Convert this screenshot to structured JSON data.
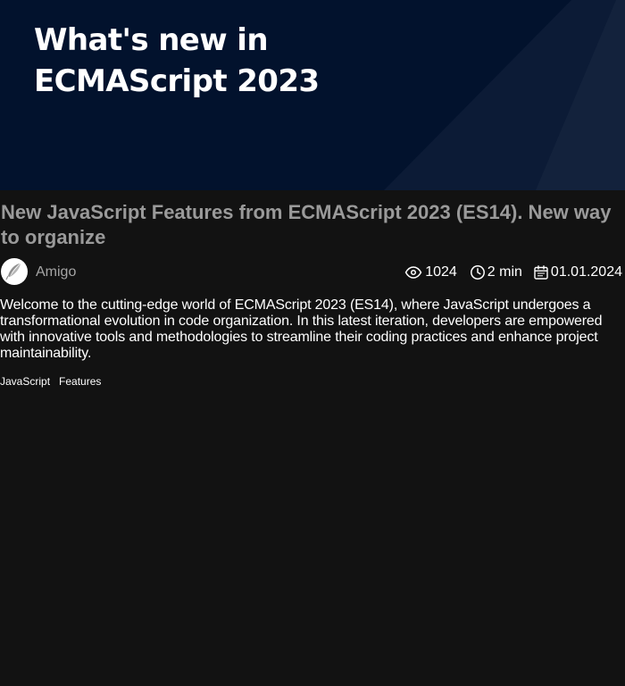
{
  "hero": {
    "title": "What's new in ECMAScript 2023"
  },
  "article": {
    "title": "New JavaScript Features from ECMAScript 2023 (ES14). New way to organize",
    "author": "Amigo",
    "views": "1024",
    "read_time": "2 min",
    "date": "01.01.2024",
    "description": "Welcome to the cutting-edge world of ECMAScript 2023 (ES14), where JavaScript undergoes a transformational evolution in code organization. In this latest iteration, developers are empowered with innovative tools and methodologies to streamline their coding practices and enhance project maintainability.",
    "tags": [
      "JavaScript",
      "Features"
    ]
  },
  "icons": {
    "avatar": "feather-avatar-icon",
    "views": "eye-icon",
    "time": "clock-icon",
    "date": "calendar-icon"
  },
  "colors": {
    "hero_background": "#02122d",
    "page_background": "#121212",
    "title_text": "#9a9a9a",
    "body_text": "#ffffff"
  }
}
